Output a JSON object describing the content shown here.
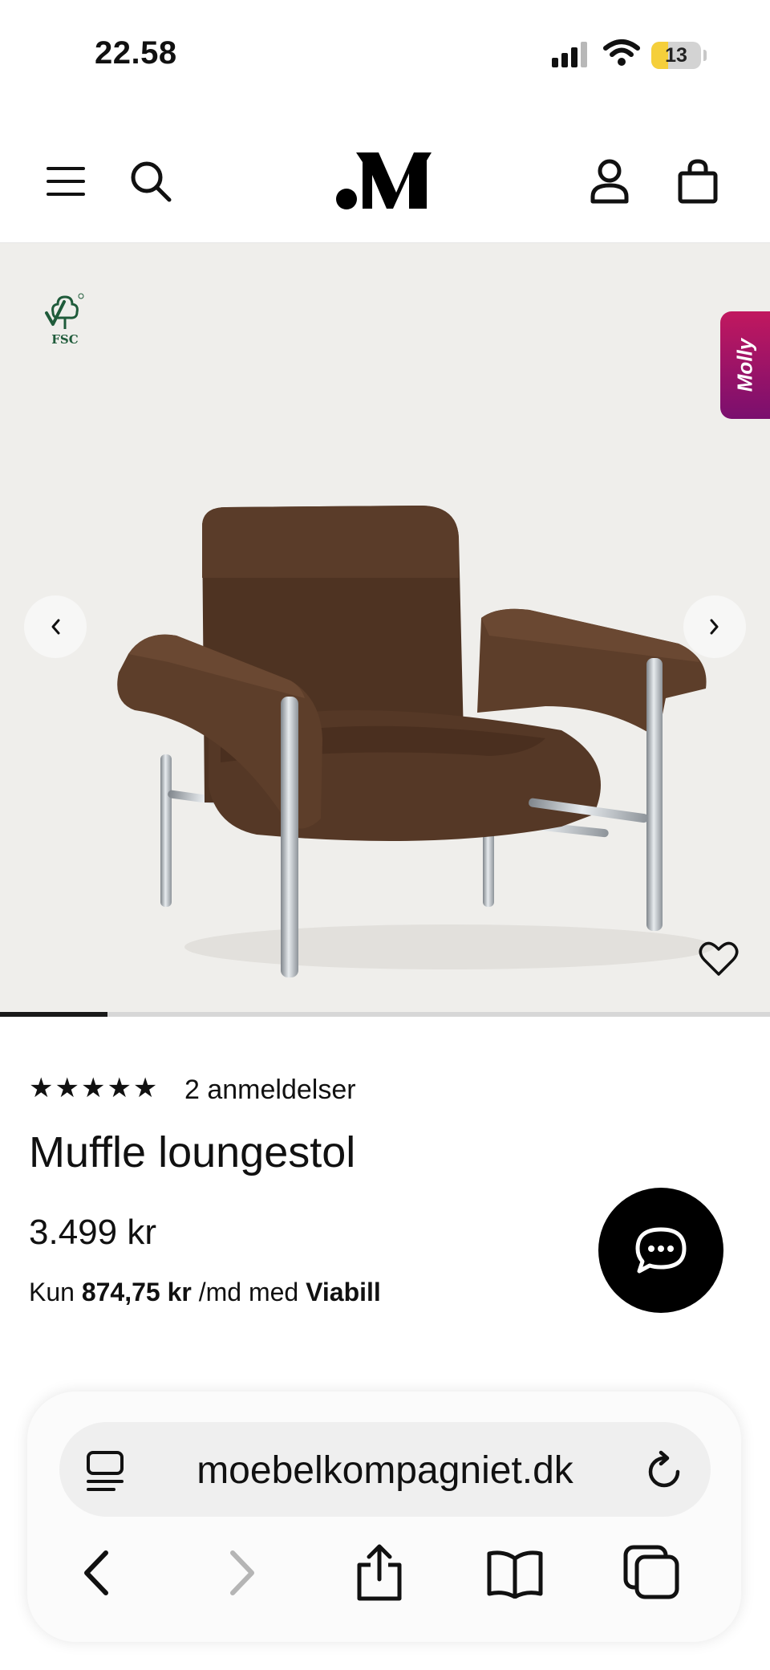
{
  "status_bar": {
    "time": "22.58",
    "battery": "13"
  },
  "header": {
    "logo_text": ".M"
  },
  "gallery": {
    "badge_text": "FSC",
    "molly_label": "Molly",
    "image_progress": 0.14
  },
  "product": {
    "stars": "★★★★★",
    "rating": 5,
    "reviews": "2 anmeldelser",
    "title": "Muffle loungestol",
    "price": "3.499 kr",
    "financing": {
      "prefix": "Kun",
      "amount": "874,75 kr",
      "middle": "/md med",
      "provider": "Viabill"
    }
  },
  "browser": {
    "url": "moebelkompagniet.dk"
  },
  "colors": {
    "gallery_bg": "#efeeeb",
    "molly_gradient_top": "#c1185f",
    "molly_gradient_bottom": "#7a0f6e",
    "battery_fill": "#f5cf3b",
    "fsc_green": "#1f5b3a"
  }
}
